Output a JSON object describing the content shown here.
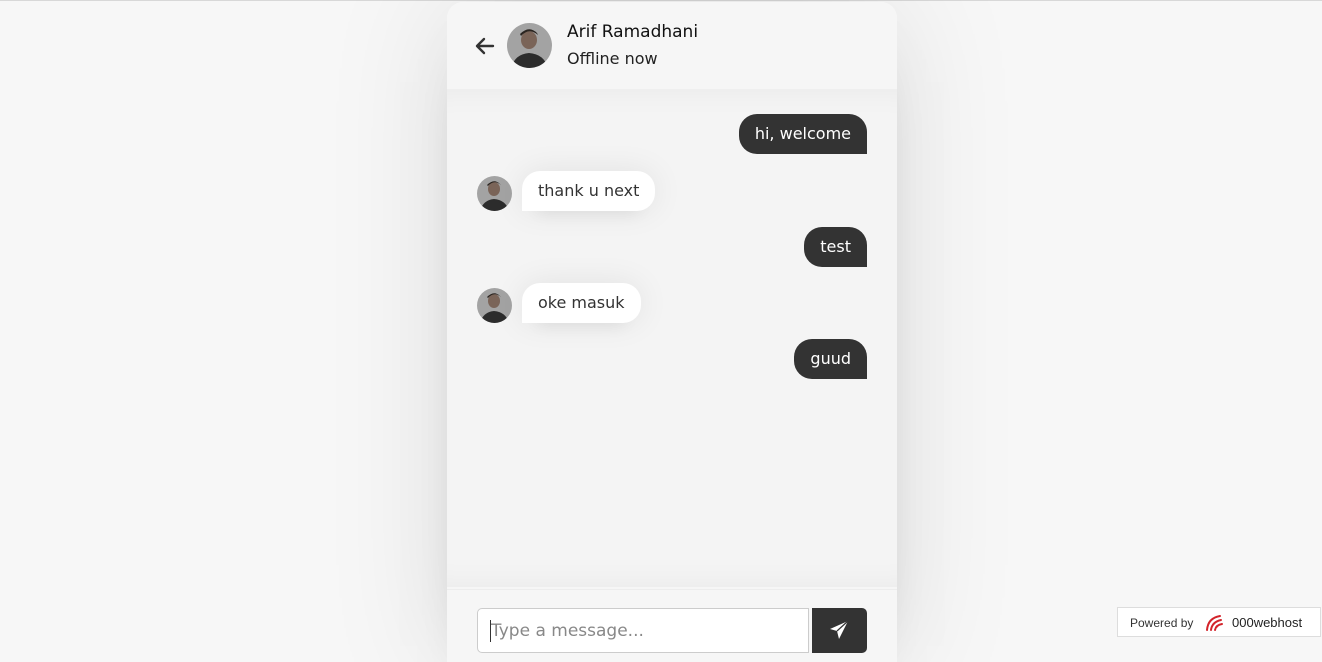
{
  "header": {
    "name": "Arif Ramadhani",
    "status": "Offline now"
  },
  "messages": [
    {
      "direction": "outgoing",
      "text": "hi, welcome"
    },
    {
      "direction": "incoming",
      "text": "thank u next"
    },
    {
      "direction": "outgoing",
      "text": "test"
    },
    {
      "direction": "incoming",
      "text": "oke masuk"
    },
    {
      "direction": "outgoing",
      "text": "guud"
    }
  ],
  "composer": {
    "placeholder": "Type a message..."
  },
  "icons": {
    "back": "arrow-left-icon",
    "send": "paper-plane-icon"
  },
  "colors": {
    "outgoing_bubble": "#333333",
    "incoming_bubble": "#ffffff",
    "send_button": "#333333"
  },
  "footer_badge": {
    "label": "Powered by",
    "brand": "000webhost"
  }
}
